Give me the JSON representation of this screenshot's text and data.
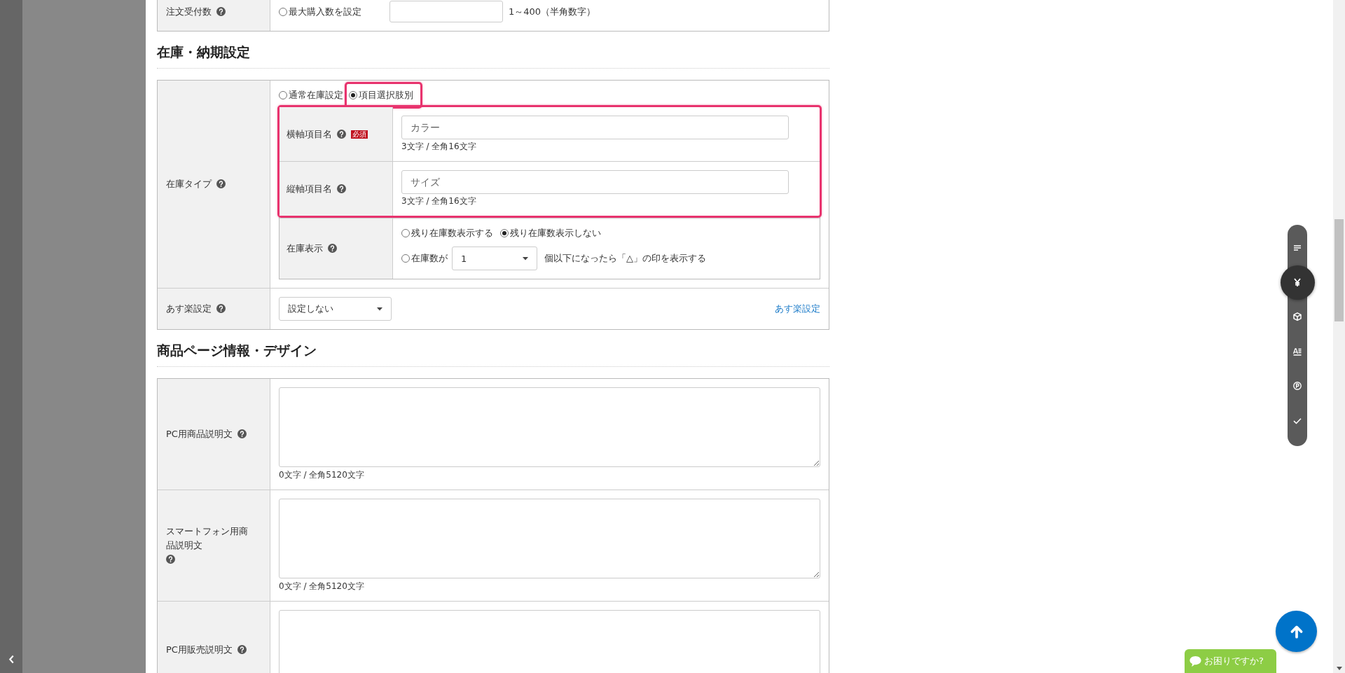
{
  "sections": [
    {
      "rows": [
        {
          "kind": "radio_input",
          "label": "注文受付数",
          "help": true,
          "options": [
            {
              "label": "最大購入数を設定",
              "selected": false
            }
          ],
          "hint": "1～400（半角数字）"
        }
      ]
    },
    {
      "title": "在庫・納期設定",
      "rows": [
        {
          "kind": "stock_type",
          "label": "在庫タイプ",
          "help": true,
          "options": [
            {
              "label": "通常在庫設定",
              "selected": false,
              "highlighted": false
            },
            {
              "label": "項目選択肢別",
              "selected": true,
              "highlighted": true
            }
          ],
          "subrows": [
            {
              "kind": "text",
              "label": "横軸項目名",
              "help": true,
              "required": "必須",
              "placeholder": "カラー",
              "counter": "3文字 / 全角16文字",
              "highlighted": true
            },
            {
              "kind": "text",
              "label": "縦軸項目名",
              "help": true,
              "placeholder": "サイズ",
              "counter": "3文字 / 全角16文字",
              "highlighted": true
            },
            {
              "kind": "stock_display",
              "label": "在庫表示",
              "help": true,
              "highlighted": false,
              "options": [
                {
                  "label": "残り在庫数表示する",
                  "selected": false
                },
                {
                  "label": "残り在庫数表示しない",
                  "selected": true
                }
              ],
              "threshold": {
                "label": "在庫数が",
                "selected": false,
                "value": "1",
                "suffix": "個以下になったら「△」の印を表示する"
              }
            }
          ]
        },
        {
          "kind": "select_link",
          "label": "あす楽設定",
          "help": true,
          "select": "設定しない",
          "link": "あす楽設定"
        }
      ]
    },
    {
      "title": "商品ページ情報・デザイン",
      "rows": [
        {
          "kind": "textarea",
          "label": "PC用商品説明文",
          "help": true,
          "counter": "0文字 / 全角5120文字"
        },
        {
          "kind": "textarea",
          "label": "スマートフォン用商品説明文",
          "help": true,
          "counter": "0文字 / 全角5120文字"
        },
        {
          "kind": "textarea",
          "label": "PC用販売説明文",
          "help": true
        }
      ]
    }
  ],
  "section_nav": [
    {
      "kind": "list",
      "selected": false
    },
    {
      "kind": "yen",
      "selected": true
    },
    {
      "kind": "box",
      "selected": false
    },
    {
      "kind": "text",
      "selected": false
    },
    {
      "kind": "point",
      "selected": false
    },
    {
      "kind": "check",
      "selected": false
    }
  ],
  "help_chip": {
    "label": "お困りですか?"
  }
}
